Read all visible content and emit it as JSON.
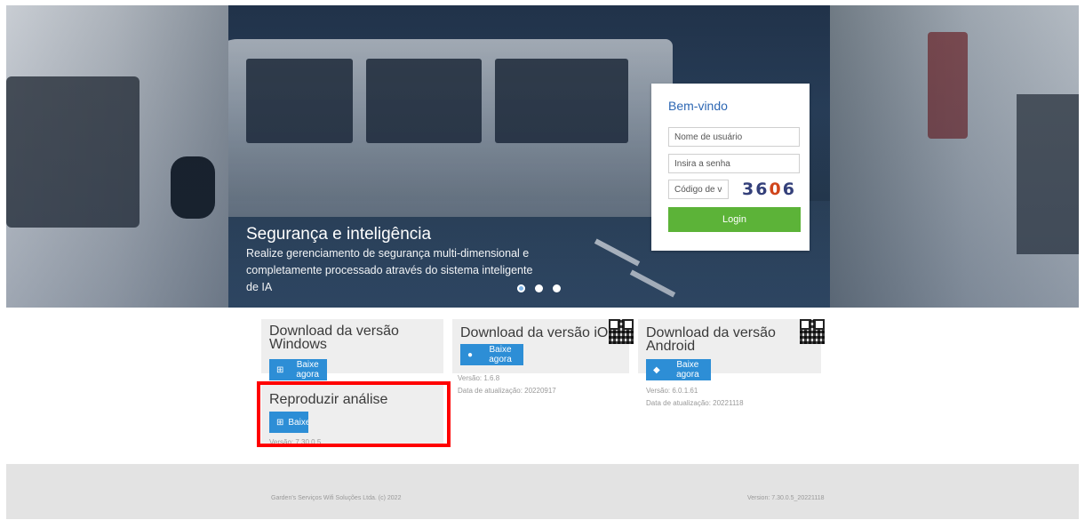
{
  "hero": {
    "title": "Segurança e inteligência",
    "description": "Realize gerenciamento de segurança multi-dimensional e completamente processado através do sistema inteligente de IA",
    "slides": 3,
    "active_slide": 0
  },
  "login": {
    "welcome": "Bem-vindo",
    "username_placeholder": "Nome de usuário",
    "password_placeholder": "Insira a senha",
    "captcha_placeholder": "Código de verificação",
    "captcha_code": [
      "3",
      "6",
      "0",
      "6"
    ],
    "login_label": "Login"
  },
  "downloads": {
    "windows": {
      "title": "Download da versão Windows",
      "button": "Baixe agora"
    },
    "ios": {
      "title": "Download da versão iOS",
      "button": "Baixe agora",
      "version": "Versão: 1.6.8",
      "updated": "Data de atualização: 20220917"
    },
    "android": {
      "title": "Download da versão Android",
      "button": "Baixe agora",
      "version": "Versão: 6.0.1.61",
      "updated": "Data de atualização: 20221118"
    },
    "playback": {
      "title": "Reproduzir análise",
      "button": "Baixe agora",
      "version": "Versão: 7.30.0.5"
    }
  },
  "footer": {
    "copyright": "Garden's Serviços Wifi Soluções Ltda. (c) 2022",
    "version": "Version: 7.30.0.5_20221118"
  },
  "colors": {
    "brand_blue": "#2d67b3",
    "login_green": "#5cb338",
    "button_blue": "#2d8ed6",
    "highlight_red": "#ff0000"
  }
}
